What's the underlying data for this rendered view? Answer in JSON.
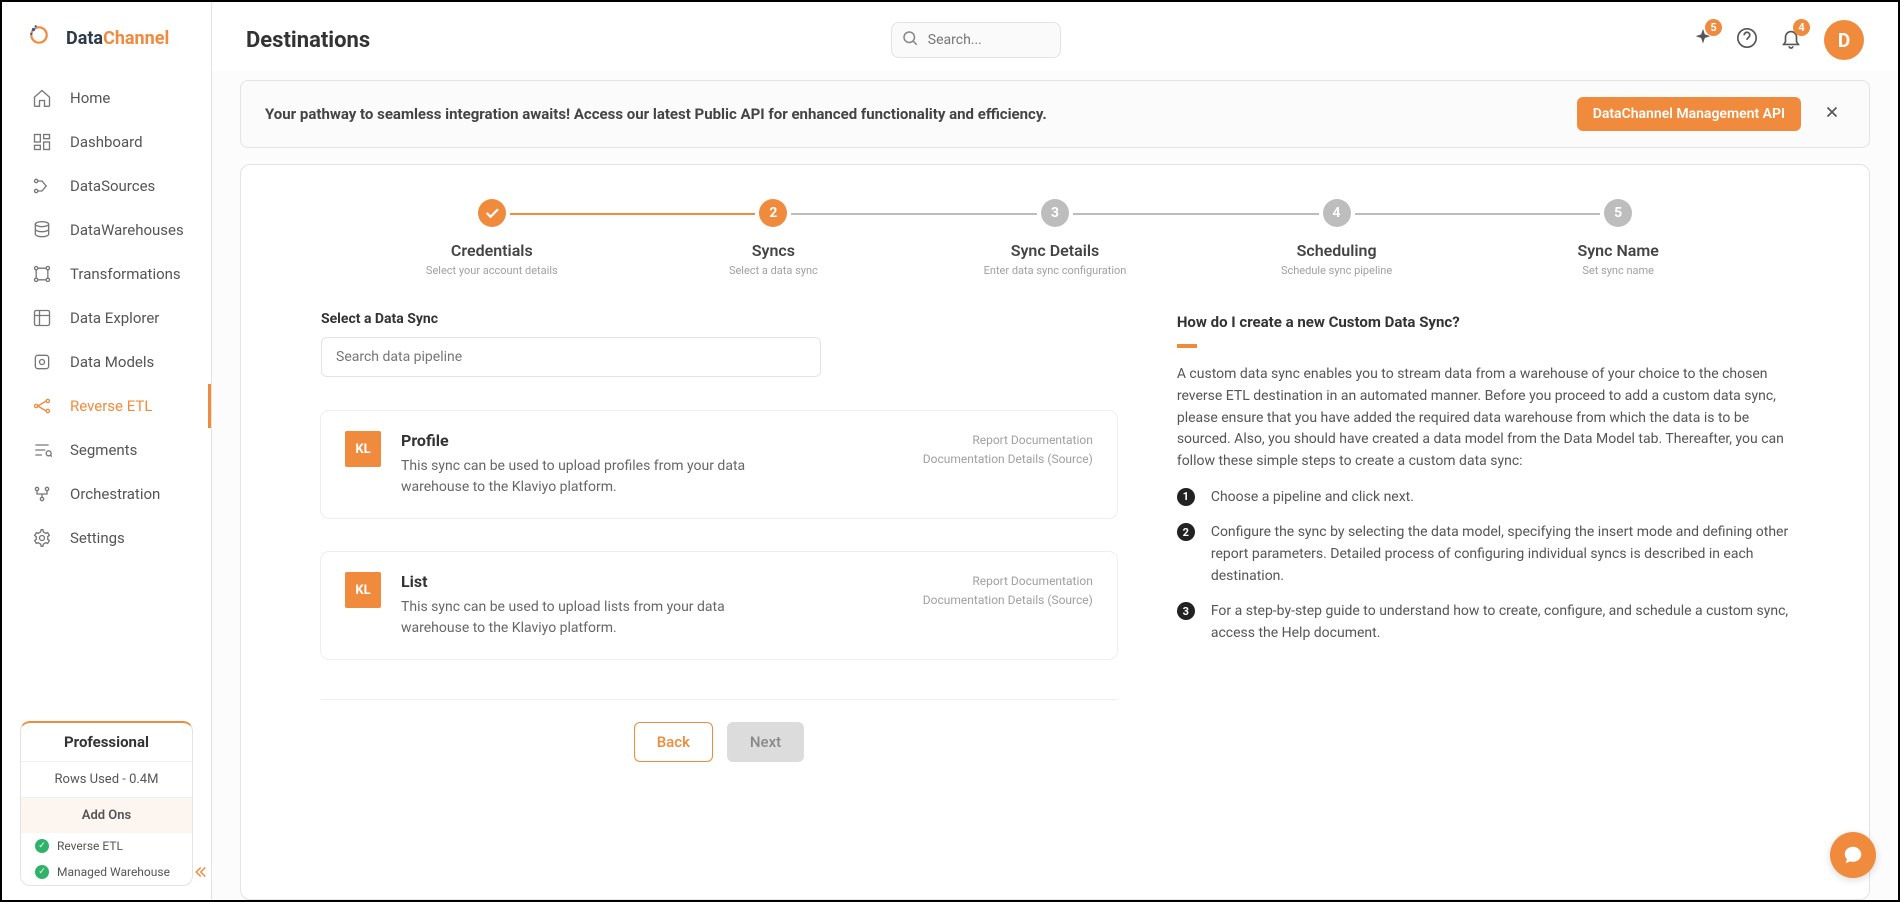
{
  "brand": {
    "name1": "Data",
    "name2": "Channel"
  },
  "page_title": "Destinations",
  "search_placeholder": "Search...",
  "badges": {
    "sparkle": "5",
    "bell": "4"
  },
  "avatar_initial": "D",
  "sidebar": {
    "items": [
      {
        "label": "Home"
      },
      {
        "label": "Dashboard"
      },
      {
        "label": "DataSources"
      },
      {
        "label": "DataWarehouses"
      },
      {
        "label": "Transformations"
      },
      {
        "label": "Data Explorer"
      },
      {
        "label": "Data Models"
      },
      {
        "label": "Reverse ETL"
      },
      {
        "label": "Segments"
      },
      {
        "label": "Orchestration"
      },
      {
        "label": "Settings"
      }
    ],
    "active_index": 7
  },
  "plan": {
    "tier": "Professional",
    "rows": "Rows Used - 0.4M",
    "addons_title": "Add Ons",
    "addons": [
      "Reverse ETL",
      "Managed Warehouse"
    ]
  },
  "banner": {
    "text": "Your pathway to seamless integration awaits! Access our latest Public API for enhanced functionality and efficiency.",
    "cta": "DataChannel Management API"
  },
  "steps": [
    {
      "title": "Credentials",
      "sub": "Select your account details",
      "state": "done"
    },
    {
      "title": "Syncs",
      "sub": "Select a data sync",
      "state": "active",
      "num": "2"
    },
    {
      "title": "Sync Details",
      "sub": "Enter data sync configuration",
      "num": "3"
    },
    {
      "title": "Scheduling",
      "sub": "Schedule sync pipeline",
      "num": "4"
    },
    {
      "title": "Sync Name",
      "sub": "Set sync name",
      "num": "5"
    }
  ],
  "section_label": "Select a Data Sync",
  "pipeline_placeholder": "Search data pipeline",
  "syncs": [
    {
      "badge": "KL",
      "title": "Profile",
      "desc": "This sync can be used to upload profiles from your data warehouse to the Klaviyo platform.",
      "link1": "Report Documentation",
      "link2": "Documentation Details (Source)"
    },
    {
      "badge": "KL",
      "title": "List",
      "desc": "This sync can be used to upload lists from your data warehouse to the Klaviyo platform.",
      "link1": "Report Documentation",
      "link2": "Documentation Details (Source)"
    }
  ],
  "buttons": {
    "back": "Back",
    "next": "Next"
  },
  "help": {
    "title": "How do I create a new Custom Data Sync?",
    "intro": "A custom data sync enables you to stream data from a warehouse of your choice to the chosen reverse ETL destination in an automated manner. Before you proceed to add a custom data sync, please ensure that you have added the required data warehouse from which the data is to be sourced. Also, you should have created a data model from the Data Model tab. Thereafter, you can follow these simple steps to create a custom data sync:",
    "steps": [
      "Choose a pipeline and click next.",
      "Configure the sync by selecting the data model, specifying the insert mode and defining other report parameters. Detailed process of configuring individual syncs is described in each destination.",
      "For a step-by-step guide to understand how to create, configure, and schedule a custom sync, access the Help document."
    ]
  }
}
